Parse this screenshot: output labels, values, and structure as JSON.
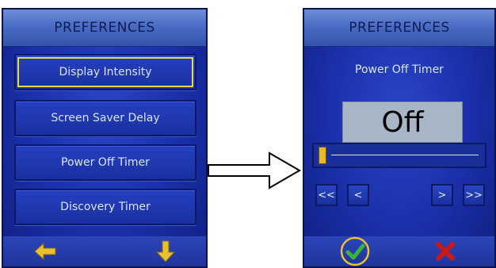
{
  "left_screen": {
    "title": "PREFERENCES",
    "menu": [
      {
        "label": "Display Intensity",
        "selected": true
      },
      {
        "label": "Screen Saver Delay",
        "selected": false
      },
      {
        "label": "Power Off Timer",
        "selected": false
      },
      {
        "label": "Discovery Timer",
        "selected": false
      }
    ],
    "bottom_icons": [
      "left-arrow-icon",
      "down-arrow-icon"
    ]
  },
  "transition_icon": "right-arrow-icon",
  "right_screen": {
    "title": "PREFERENCES",
    "setting_name": "Power Off Timer",
    "value": "Off",
    "slider_level": 0,
    "nav_buttons": [
      "<<",
      "<",
      ">",
      ">>"
    ],
    "actions": [
      "check-icon",
      "cross-icon"
    ]
  },
  "colors": {
    "screen_bg": "#1a2fa8",
    "title_bar": "#4a6cc4",
    "button_text": "#d8e4ff",
    "selection_outline": "#e8d84a",
    "arrow_yellow": "#e8c030",
    "check_green": "#3ab43a",
    "cross_red": "#c81818"
  }
}
